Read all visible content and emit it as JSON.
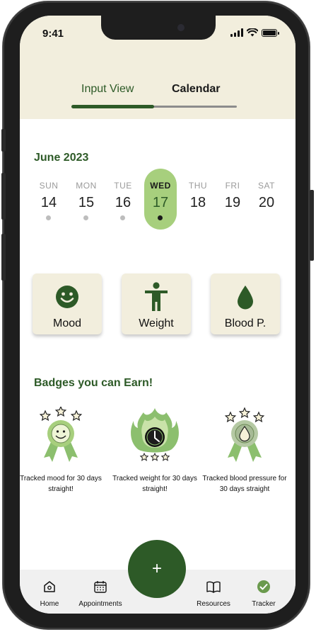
{
  "status": {
    "time": "9:41"
  },
  "tabs": {
    "input_view": "Input View",
    "calendar": "Calendar",
    "progress": 0.5
  },
  "calendar": {
    "month": "June 2023",
    "days": [
      {
        "name": "SUN",
        "num": "14",
        "has_entry": true
      },
      {
        "name": "MON",
        "num": "15",
        "has_entry": true
      },
      {
        "name": "TUE",
        "num": "16",
        "has_entry": true
      },
      {
        "name": "WED",
        "num": "17",
        "has_entry": true,
        "selected": true
      },
      {
        "name": "THU",
        "num": "18",
        "has_entry": false
      },
      {
        "name": "FRI",
        "num": "19",
        "has_entry": false
      },
      {
        "name": "SAT",
        "num": "20",
        "has_entry": false
      }
    ]
  },
  "trackers": [
    {
      "label": "Mood",
      "icon": "smiley-icon"
    },
    {
      "label": "Weight",
      "icon": "person-icon"
    },
    {
      "label": "Blood P.",
      "icon": "droplet-icon"
    }
  ],
  "badges": {
    "title": "Badges you can Earn!",
    "items": [
      {
        "text": "Tracked mood for 30 days straight!",
        "icon": "mood-medal-icon"
      },
      {
        "text": "Tracked weight for 30 days straight!",
        "icon": "flame-clock-icon"
      },
      {
        "text": "Tracked blood pressure for 30 days straight",
        "icon": "blood-medal-icon"
      }
    ]
  },
  "fab": {
    "label": "+"
  },
  "nav": {
    "home": "Home",
    "appointments": "Appointments",
    "resources": "Resources",
    "tracker": "Tracker"
  },
  "colors": {
    "brand_green": "#2d5a27",
    "light_green": "#a7cf7d",
    "cream": "#f2eedd",
    "nav_bg": "#f0f0f0"
  }
}
